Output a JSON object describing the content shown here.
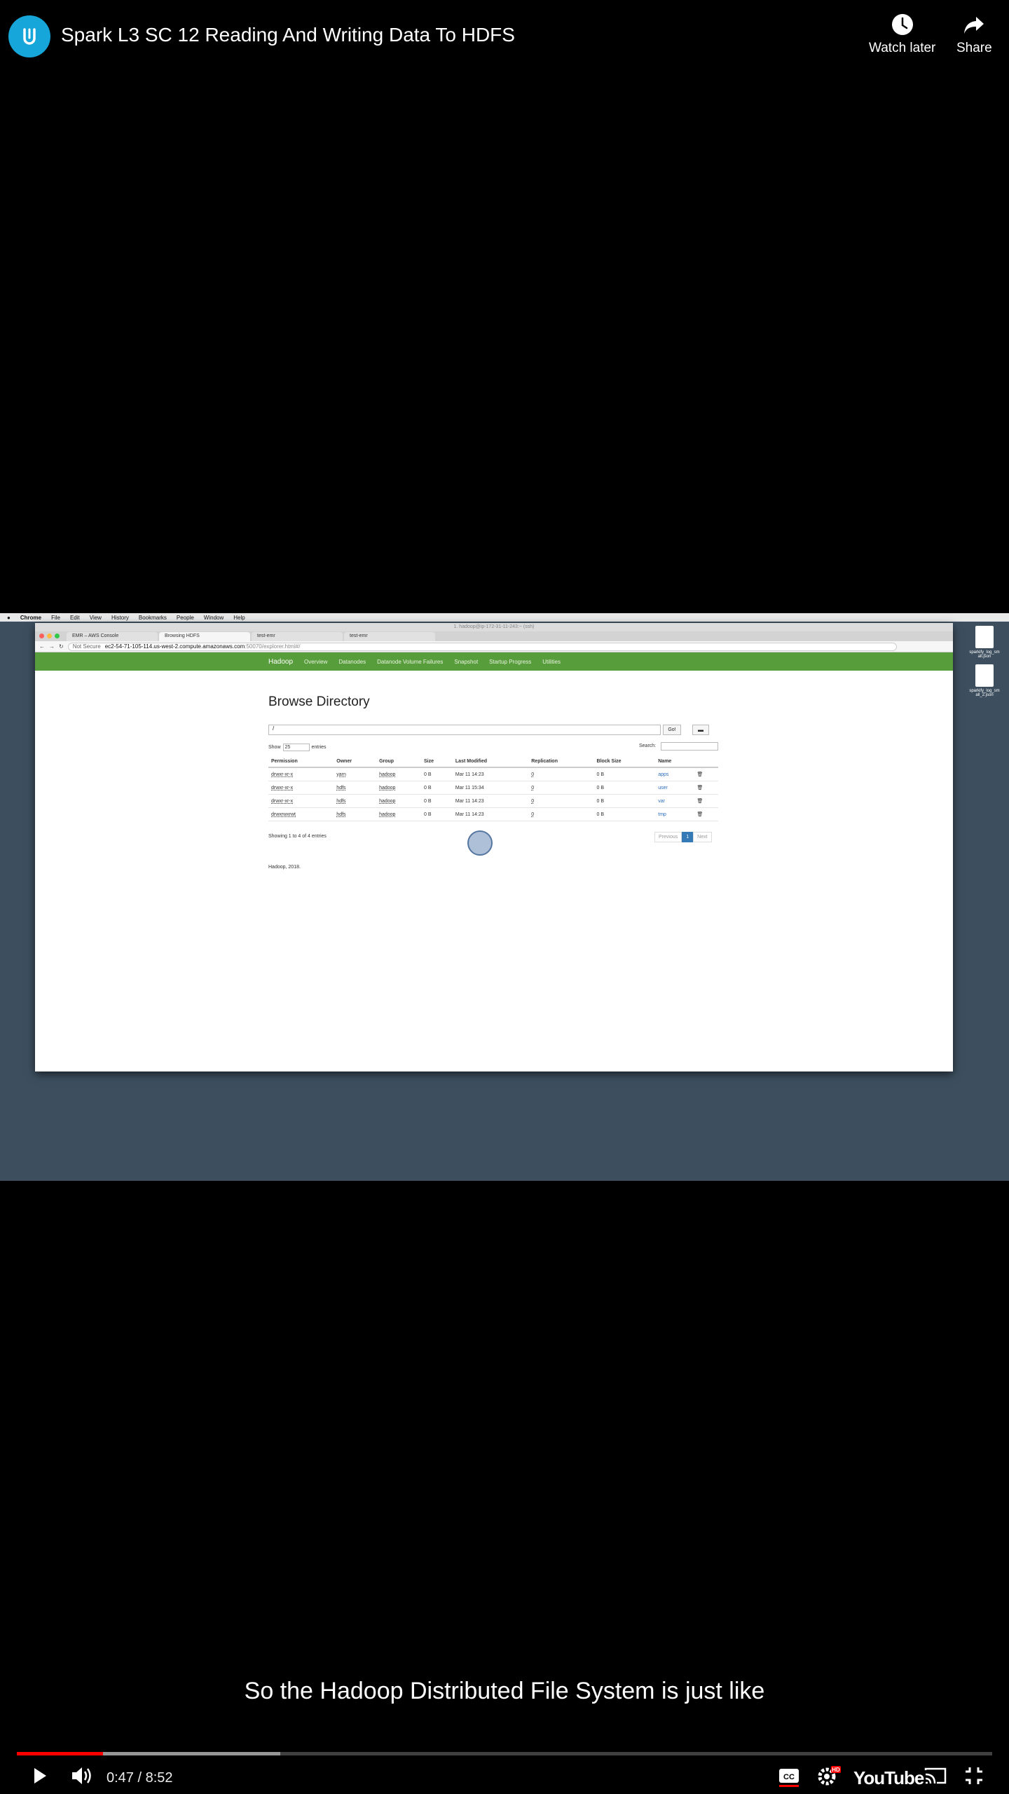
{
  "header": {
    "title": "Spark L3 SC 12 Reading And Writing Data To HDFS",
    "watch_later": "Watch later",
    "share": "Share"
  },
  "screen": {
    "menubar": [
      "Chrome",
      "File",
      "Edit",
      "View",
      "History",
      "Bookmarks",
      "People",
      "Window",
      "Help"
    ],
    "terminal_title": "1. hadoop@ip-172-31-11-243:~ (ssh)",
    "tabs": [
      "EMR – AWS Console",
      "Browsing HDFS",
      "test-emr",
      "test-emr"
    ],
    "address": {
      "security": "Not Secure",
      "host": "ec2-54-71-105-114.us-west-2.compute.amazonaws.com",
      "rest": ":50070/explorer.html#/"
    },
    "desktop_files": [
      "sparkify_log_sm all.json",
      "sparkify_log_sm all_2.json"
    ],
    "hadoop_nav": {
      "brand": "Hadoop",
      "items": [
        "Overview",
        "Datanodes",
        "Datanode Volume Failures",
        "Snapshot",
        "Startup Progress",
        "Utilities"
      ]
    },
    "page_title": "Browse Directory",
    "path_value": "/",
    "go_label": "Go!",
    "show_label": "Show",
    "show_value": "25",
    "entries_label": "entries",
    "search_label": "Search:",
    "table": {
      "headers": [
        "Permission",
        "Owner",
        "Group",
        "Size",
        "Last Modified",
        "Replication",
        "Block Size",
        "Name"
      ],
      "rows": [
        {
          "permission": "drwxr-xr-x",
          "owner": "yarn",
          "group": "hadoop",
          "size": "0 B",
          "modified": "Mar 11 14:23",
          "replication": "0",
          "block_size": "0 B",
          "name": "apps"
        },
        {
          "permission": "drwxr-xr-x",
          "owner": "hdfs",
          "group": "hadoop",
          "size": "0 B",
          "modified": "Mar 11 15:34",
          "replication": "0",
          "block_size": "0 B",
          "name": "user"
        },
        {
          "permission": "drwxr-xr-x",
          "owner": "hdfs",
          "group": "hadoop",
          "size": "0 B",
          "modified": "Mar 11 14:23",
          "replication": "0",
          "block_size": "0 B",
          "name": "var"
        },
        {
          "permission": "drwxrwxrwt",
          "owner": "hdfs",
          "group": "hadoop",
          "size": "0 B",
          "modified": "Mar 11 14:23",
          "replication": "0",
          "block_size": "0 B",
          "name": "tmp"
        }
      ]
    },
    "showing": "Showing 1 to 4 of 4 entries",
    "pager": {
      "previous": "Previous",
      "current": "1",
      "next": "Next"
    },
    "footer": "Hadoop, 2018."
  },
  "caption": "So the Hadoop Distributed File System is just like",
  "player": {
    "time": "0:47 / 8:52",
    "played_fraction": 0.0883,
    "buffered_fraction": 0.27,
    "youtube": "YouTube",
    "hd_badge": "HD"
  },
  "colors": {
    "accent_red": "#ff0000",
    "hadoop_green": "#589d3b",
    "logo_blue": "#16a6d9"
  }
}
